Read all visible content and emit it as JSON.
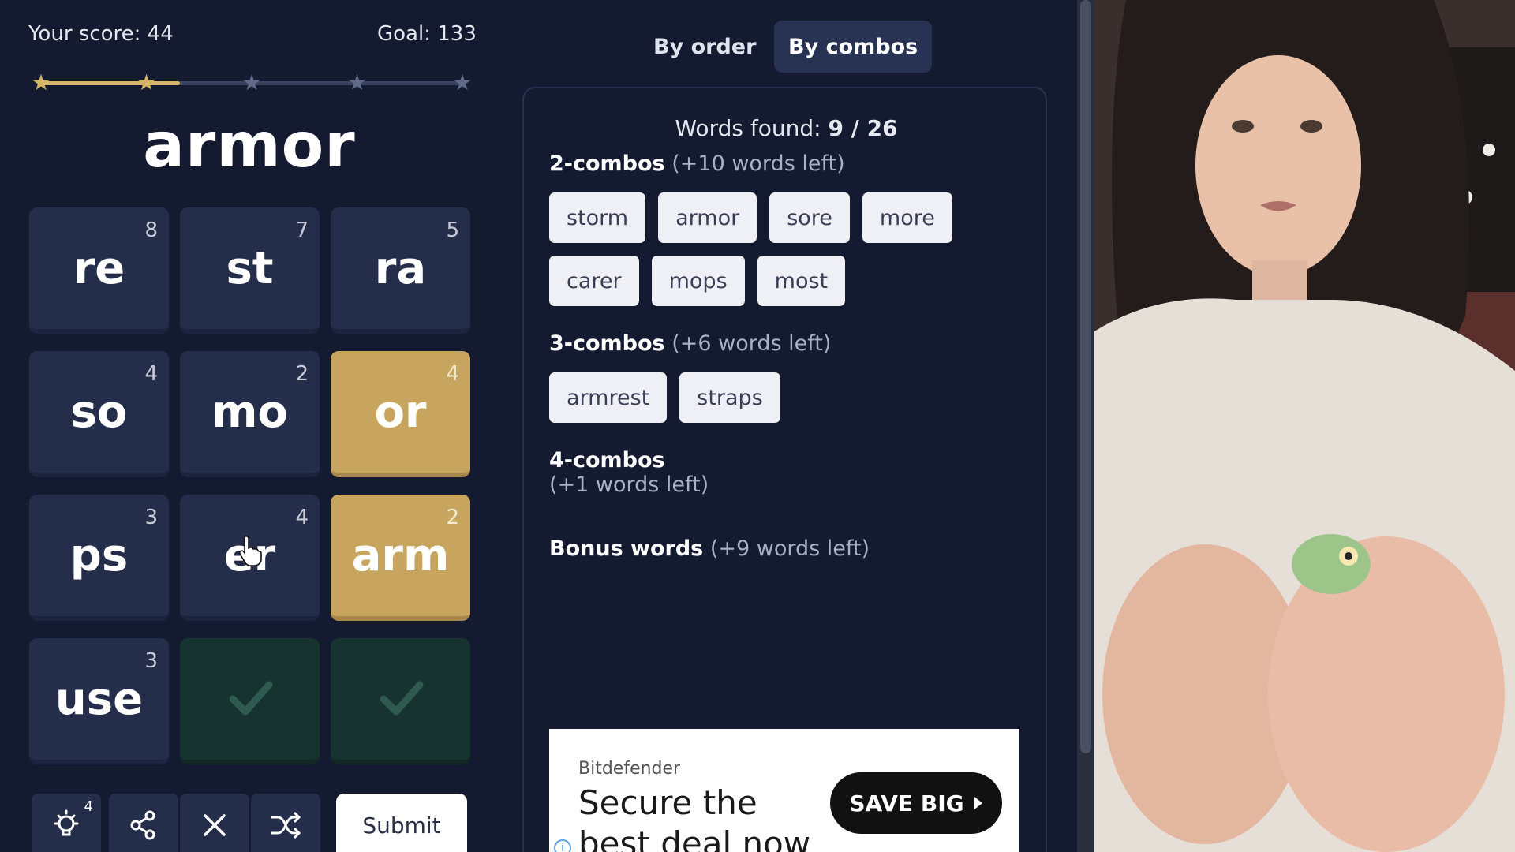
{
  "game": {
    "score_label": "Your score: 44",
    "goal_label": "Goal: 133",
    "progress_fraction": 0.33,
    "stars_earned": 2,
    "stars_total": 5,
    "current_word": "armor",
    "tiles": [
      {
        "text": "re",
        "count": "8",
        "state": "normal"
      },
      {
        "text": "st",
        "count": "7",
        "state": "normal"
      },
      {
        "text": "ra",
        "count": "5",
        "state": "normal"
      },
      {
        "text": "so",
        "count": "4",
        "state": "normal"
      },
      {
        "text": "mo",
        "count": "2",
        "state": "normal"
      },
      {
        "text": "or",
        "count": "4",
        "state": "selected"
      },
      {
        "text": "ps",
        "count": "3",
        "state": "normal"
      },
      {
        "text": "er",
        "count": "4",
        "state": "normal"
      },
      {
        "text": "arm",
        "count": "2",
        "state": "selected"
      },
      {
        "text": "use",
        "count": "3",
        "state": "normal"
      },
      {
        "text": "",
        "count": "",
        "state": "done"
      },
      {
        "text": "",
        "count": "",
        "state": "done"
      }
    ],
    "toolbar": {
      "hint_count": "4",
      "submit_label": "Submit"
    }
  },
  "tabs": {
    "by_order": "By order",
    "by_combos": "By combos",
    "active": "by_combos"
  },
  "words": {
    "found_label": "Words found: ",
    "found_value": "9 / 26",
    "sections": [
      {
        "title": "2-combos",
        "left": "(+10 words left)",
        "words": [
          "storm",
          "armor",
          "sore",
          "more",
          "carer",
          "mops",
          "most"
        ]
      },
      {
        "title": "3-combos",
        "left": "(+6 words left)",
        "words": [
          "armrest",
          "straps"
        ]
      },
      {
        "title": "4-combos",
        "left": "(+1 words left)",
        "words": []
      },
      {
        "title": "Bonus words",
        "left": "(+9 words left)",
        "words": []
      }
    ]
  },
  "ad": {
    "brand": "Bitdefender",
    "headline": "Secure the best deal now",
    "cta": "SAVE BIG"
  },
  "colors": {
    "background": "#141a30",
    "tile": "#242d4a",
    "tile_selected": "#c7a55e",
    "tile_done": "#17332f",
    "star_gold": "#d4b566",
    "star_empty": "#5e6a88"
  },
  "icons": [
    "star-icon",
    "check-icon",
    "lightbulb-icon",
    "share-icon",
    "close-icon",
    "shuffle-icon",
    "pointer-cursor-icon",
    "info-icon",
    "play-arrow-icon"
  ]
}
